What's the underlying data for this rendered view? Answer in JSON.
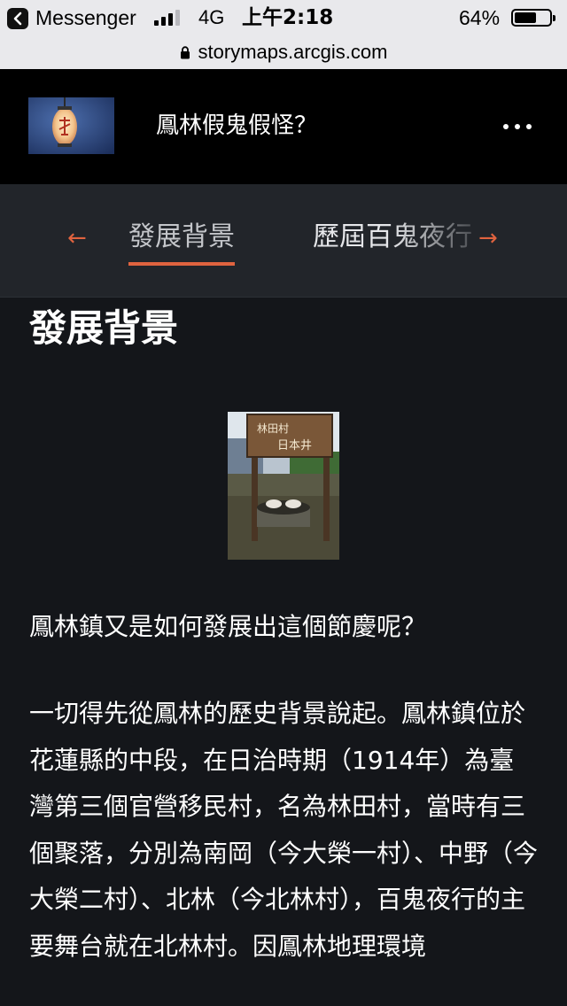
{
  "status_bar": {
    "app": "Messenger",
    "network": "4G",
    "time": "上午2:18",
    "battery_percent": "64%",
    "battery_level": 0.64
  },
  "url_bar": {
    "domain": "storymaps.arcgis.com"
  },
  "story": {
    "title": "鳳林假鬼假怪？"
  },
  "nav": {
    "prev_arrow": "←",
    "active_tab": "發展背景",
    "next_tab": "歷屆百鬼夜行",
    "next_arrow": "→",
    "accent_color": "#e0633f"
  },
  "content": {
    "heading": "發展背景",
    "paragraph_1": "鳳林鎮又是如何發展出這個節慶呢？",
    "paragraph_2": "一切得先從鳳林的歷史背景說起。鳳林鎮位於花蓮縣的中段，在日治時期（1914年）為臺灣第三個官營移民村，名為林田村，當時有三個聚落，分別為南岡（今大榮一村）、中野（今大榮二村）、北林（今北林村），百鬼夜行的主要舞台就在北林村。因鳳林地理環境",
    "photo_sign_line_1": "林田村",
    "photo_sign_line_2": "日本井"
  },
  "icons": {
    "back": "chevron-left-icon",
    "signal": "signal-icon",
    "battery": "battery-icon",
    "lock": "lock-icon",
    "more": "more-horizontal-icon"
  }
}
